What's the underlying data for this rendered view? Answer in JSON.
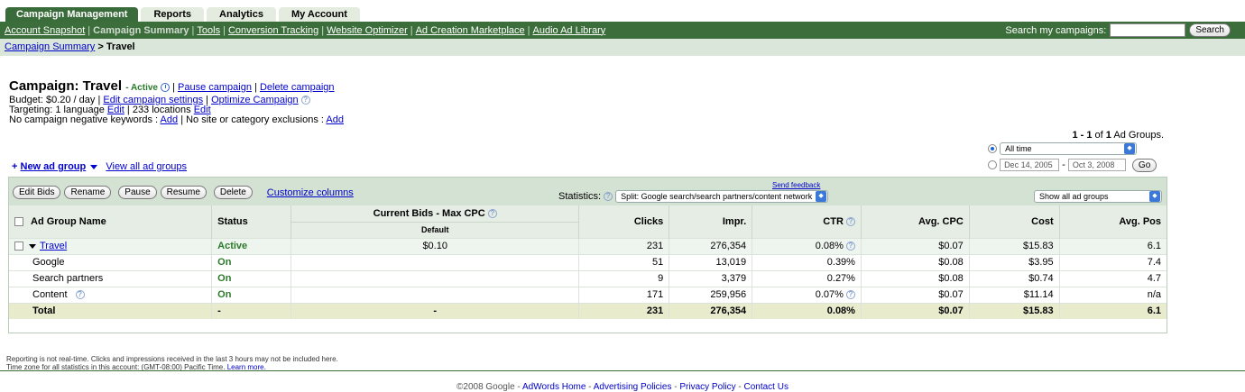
{
  "tabs": [
    {
      "label": "Campaign Management",
      "active": true
    },
    {
      "label": "Reports",
      "active": false
    },
    {
      "label": "Analytics",
      "active": false
    },
    {
      "label": "My Account",
      "active": false
    }
  ],
  "nav": {
    "links": [
      "Account Snapshot",
      "Campaign Summary",
      "Tools",
      "Conversion Tracking",
      "Website Optimizer",
      "Ad Creation Marketplace",
      "Audio Ad Library"
    ],
    "search_label": "Search my campaigns:",
    "search_value": "",
    "search_button": "Search"
  },
  "breadcrumb": {
    "link": "Campaign Summary",
    "sep": " > ",
    "current": "Travel"
  },
  "campaign": {
    "title": "Campaign: Travel",
    "status": "- Active",
    "pause": "Pause campaign",
    "delete": "Delete campaign",
    "budget_text": "Budget: $0.20 / day",
    "edit_settings": "Edit campaign settings",
    "optimize": "Optimize Campaign",
    "targeting_text": "Targeting: 1 language",
    "edit": "Edit",
    "locations_text": "| 233 locations",
    "negatives_text": "No campaign negative keywords :",
    "add": "Add",
    "exclusions_text": "| No site or category exclusions :"
  },
  "paging": {
    "range": "1 - 1",
    "of_text": "of",
    "total": "1",
    "suffix": "Ad Groups."
  },
  "daterange": {
    "preset": "All time",
    "start": "Dec 14, 2005",
    "dash": "-",
    "end": "Oct 3, 2008",
    "go": "Go"
  },
  "new_ad_group": "New ad group",
  "view_all": "View all ad groups",
  "toolbar": {
    "buttons": [
      "Edit Bids",
      "Rename",
      "Pause",
      "Resume",
      "Delete"
    ],
    "customize": "Customize columns",
    "statistics_label": "Statistics:",
    "statistics_value": "Split: Google search/search partners/content network",
    "feedback": "Send feedback",
    "show_filter": "Show all ad groups"
  },
  "columns": {
    "name": "Ad Group Name",
    "status": "Status",
    "bids": "Current Bids - Max CPC",
    "bids_sub": "Default",
    "clicks": "Clicks",
    "impr": "Impr.",
    "ctr": "CTR",
    "avg_cpc": "Avg. CPC",
    "cost": "Cost",
    "avg_pos": "Avg. Pos"
  },
  "rows": [
    {
      "name": "Travel",
      "status": "Active",
      "bid": "$0.10",
      "clicks": "231",
      "impr": "276,354",
      "ctr": "0.08%",
      "cpc": "$0.07",
      "cost": "$15.83",
      "pos": "6.1"
    },
    {
      "name": "Google",
      "status": "On",
      "bid": "",
      "clicks": "51",
      "impr": "13,019",
      "ctr": "0.39%",
      "cpc": "$0.08",
      "cost": "$3.95",
      "pos": "7.4"
    },
    {
      "name": "Search partners",
      "status": "On",
      "bid": "",
      "clicks": "9",
      "impr": "3,379",
      "ctr": "0.27%",
      "cpc": "$0.08",
      "cost": "$0.74",
      "pos": "4.7"
    },
    {
      "name": "Content",
      "status": "On",
      "bid": "",
      "clicks": "171",
      "impr": "259,956",
      "ctr": "0.07%",
      "cpc": "$0.07",
      "cost": "$11.14",
      "pos": "n/a"
    },
    {
      "name": "Total",
      "status": "-",
      "bid": "-",
      "clicks": "231",
      "impr": "276,354",
      "ctr": "0.08%",
      "cpc": "$0.07",
      "cost": "$15.83",
      "pos": "6.1"
    }
  ],
  "note": {
    "line1": "Reporting is not real-time. Clicks and impressions received in the last 3 hours may not be included here.",
    "line2": "Time zone for all statistics in this account: (GMT-08:00) Pacific Time.",
    "learn_more": "Learn more."
  },
  "footer": {
    "copyright": "©2008 Google",
    "sep": " - ",
    "links": [
      "AdWords Home",
      "Advertising Policies",
      "Privacy Policy",
      "Contact Us"
    ]
  }
}
